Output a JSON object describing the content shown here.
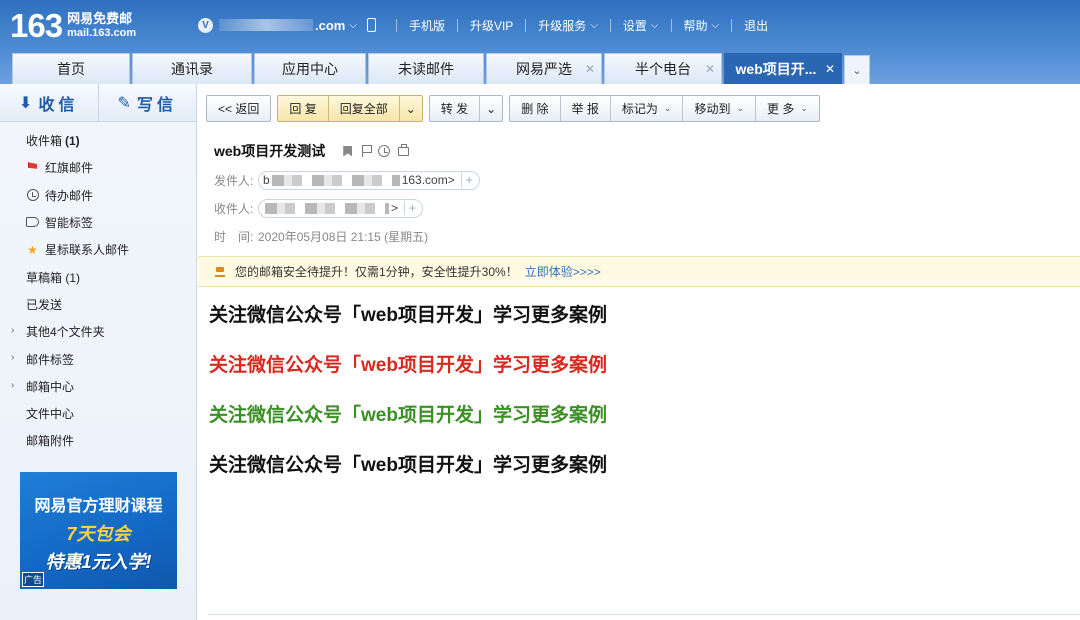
{
  "header": {
    "logo_number": "163",
    "logo_cn": "网易免费邮",
    "logo_en": "mail.163.com",
    "account_badge": "V",
    "account_domain": ".com",
    "links": [
      "手机版",
      "升级VIP",
      "升级服务",
      "设置",
      "帮助",
      "退出"
    ]
  },
  "tabs": [
    {
      "label": "首页"
    },
    {
      "label": "通讯录"
    },
    {
      "label": "应用中心"
    },
    {
      "label": "未读邮件"
    },
    {
      "label": "网易严选"
    },
    {
      "label": "半个电台"
    },
    {
      "label": "web项目开..."
    }
  ],
  "sidebar": {
    "inbox_btn": "收信",
    "compose_btn": "写信",
    "folders": [
      {
        "label": "收件箱",
        "count": "(1)"
      },
      {
        "label": "红旗邮件"
      },
      {
        "label": "待办邮件"
      },
      {
        "label": "智能标签"
      },
      {
        "label": "星标联系人邮件"
      },
      {
        "label": "草稿箱 (1)"
      },
      {
        "label": "已发送"
      },
      {
        "label": "其他4个文件夹"
      },
      {
        "label": "邮件标签"
      },
      {
        "label": "邮箱中心"
      },
      {
        "label": "文件中心"
      },
      {
        "label": "邮箱附件"
      }
    ],
    "ad": {
      "line1": "网易官方理财课程",
      "line2": "7天包会",
      "line3": "特惠1元入学!",
      "tag": "广告"
    }
  },
  "toolbar": {
    "back": "<< 返回",
    "reply": "回 复",
    "reply_all": "回复全部",
    "forward": "转 发",
    "delete": "删 除",
    "report": "举 报",
    "mark_as": "标记为",
    "move_to": "移动到",
    "more": "更 多"
  },
  "message": {
    "subject": "web项目开发测试",
    "from_label": "发件人:",
    "from_prefix": "b",
    "from_suffix": "163.com>",
    "to_label": "收件人:",
    "to_suffix": ">",
    "time_label": "时　间:",
    "time_value": "2020年05月08日 21:15 (星期五)",
    "notice_text": "您的邮箱安全待提升！仅需1分钟，安全性提升30%！",
    "notice_link": "立即体验>>>>",
    "body_lines": [
      {
        "text": "关注微信公众号「web项目开发」学习更多案例",
        "color": "#111111"
      },
      {
        "text": "关注微信公众号「web项目开发」学习更多案例",
        "color": "#d9291f"
      },
      {
        "text": "关注微信公众号「web项目开发」学习更多案例",
        "color": "#3a8f25"
      },
      {
        "text": "关注微信公众号「web项目开发」学习更多案例",
        "color": "#111111"
      }
    ]
  }
}
